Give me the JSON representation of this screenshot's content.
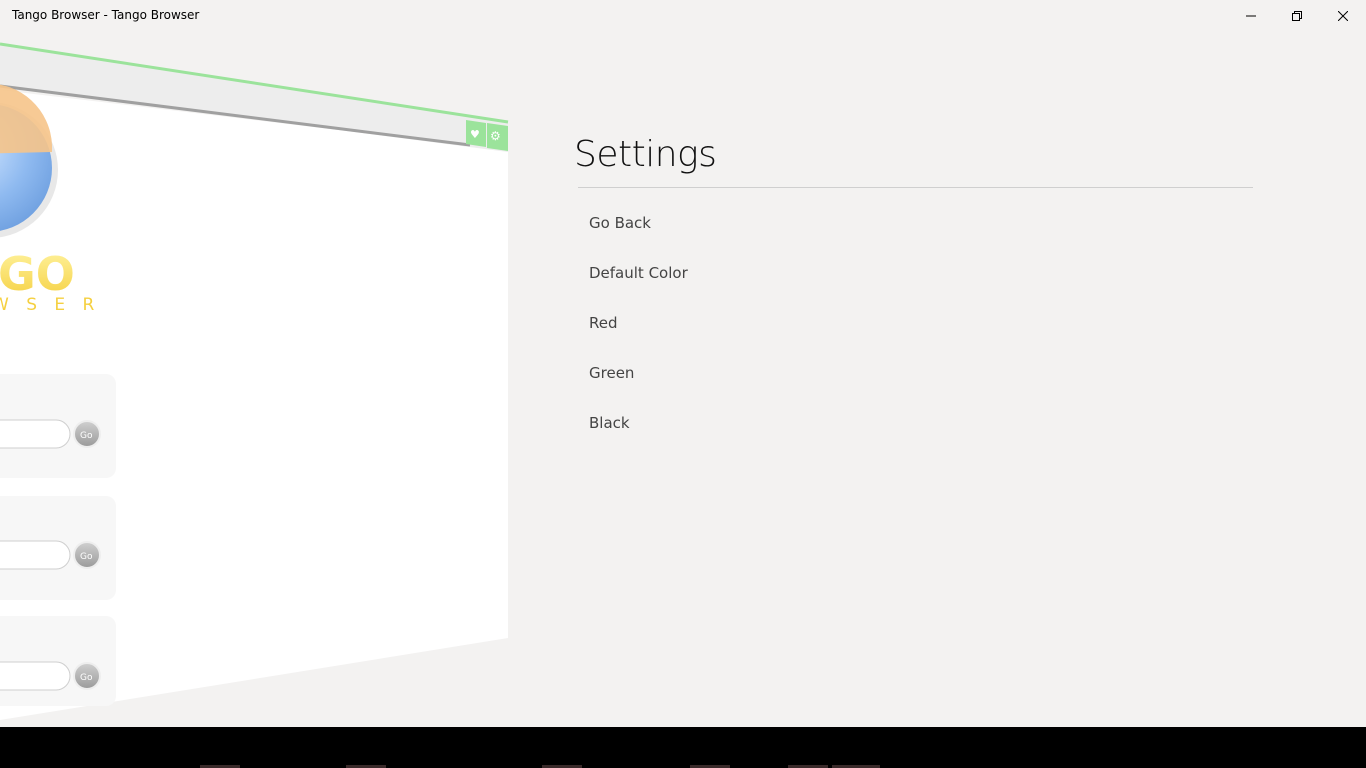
{
  "window": {
    "title": "Tango Browser - Tango Browser"
  },
  "titlebar_buttons": {
    "minimize_icon": "minimize-icon",
    "maximize_icon": "restore-icon",
    "close_icon": "close-icon"
  },
  "preview": {
    "logo_text": "GO",
    "logo_subtext": "W S E R",
    "go_label": "Go",
    "toolbar_icons": [
      "heart-icon",
      "gear-icon"
    ],
    "accent": "#9be39b"
  },
  "settings": {
    "title": "Settings",
    "items": [
      {
        "label": "Go Back"
      },
      {
        "label": "Default Color"
      },
      {
        "label": "Red"
      },
      {
        "label": "Green"
      },
      {
        "label": "Black"
      }
    ]
  }
}
